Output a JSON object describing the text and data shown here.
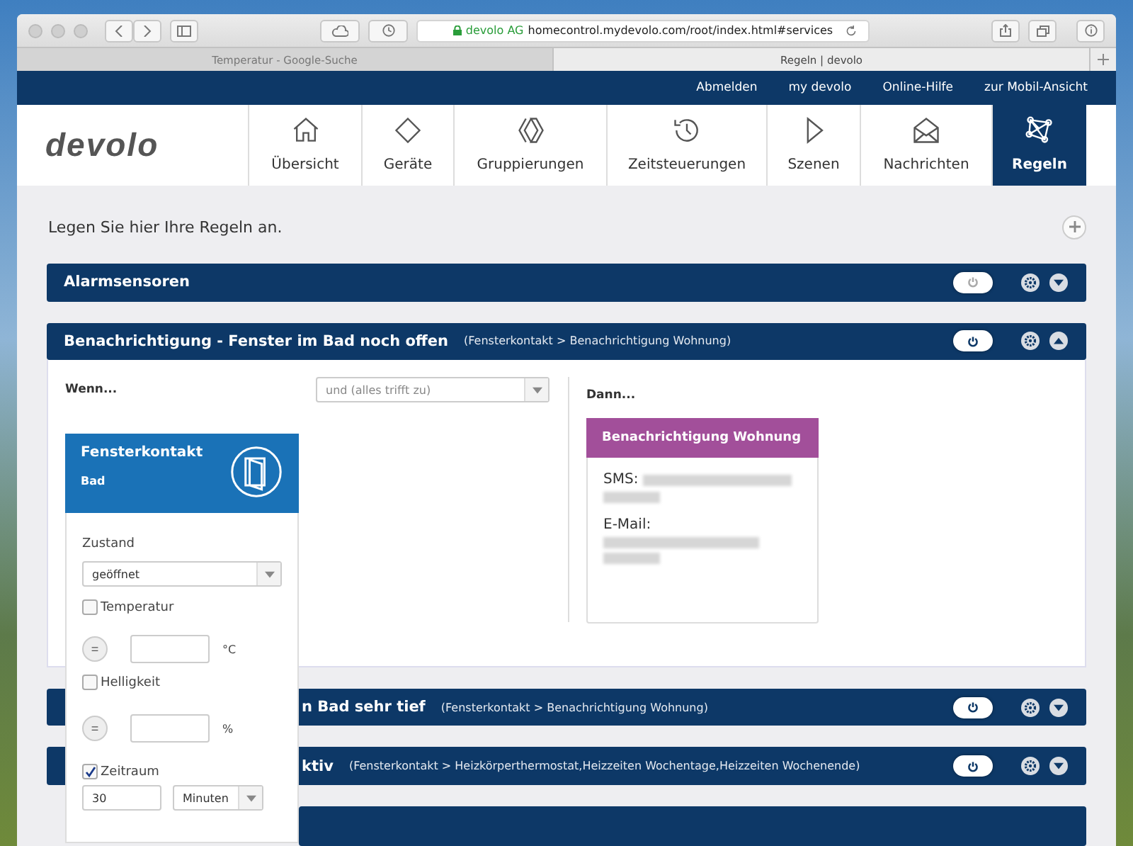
{
  "browser": {
    "tabs": [
      {
        "title": "Temperatur - Google-Suche",
        "selected": false
      },
      {
        "title": "Regeln | devolo",
        "selected": true
      }
    ],
    "address": {
      "owner": "devolo AG",
      "url": "homecontrol.mydevolo.com/root/index.html#services"
    }
  },
  "top_links": [
    "Abmelden",
    "my devolo",
    "Online-Hilfe",
    "zur Mobil-Ansicht"
  ],
  "logo": "devolo",
  "nav": [
    {
      "label": "Übersicht",
      "selected": false
    },
    {
      "label": "Geräte",
      "selected": false
    },
    {
      "label": "Gruppierungen",
      "selected": false
    },
    {
      "label": "Zeitsteuerungen",
      "selected": false
    },
    {
      "label": "Szenen",
      "selected": false
    },
    {
      "label": "Nachrichten",
      "selected": false
    },
    {
      "label": "Regeln",
      "selected": true
    }
  ],
  "intro": "Legen Sie hier Ihre Regeln an.",
  "rules": [
    {
      "title": "Alarmsensoren",
      "on": false,
      "expanded": false
    },
    {
      "title": "Benachrichtigung - Fenster im Bad noch offen",
      "detail": "(Fensterkontakt > Benachrichtigung Wohnung)",
      "on": true,
      "expanded": true
    },
    {
      "title": "n Bad sehr tief",
      "detail": "(Fensterkontakt > Benachrichtigung Wohnung)",
      "on": true,
      "expanded": false
    },
    {
      "title": "ktiv",
      "detail": "(Fensterkontakt > Heizkörperthermostat,Heizzeiten Wochentage,Heizzeiten Wochenende)",
      "on": true,
      "expanded": false
    }
  ],
  "editor": {
    "when_label": "Wenn...",
    "combine": "und (alles trifft zu)",
    "then_label": "Dann...",
    "trigger": {
      "title": "Fensterkontakt",
      "room": "Bad",
      "state_label": "Zustand",
      "state": "geöffnet",
      "conditions": [
        {
          "label": "Temperatur",
          "checked": false,
          "operator": "=",
          "unit": "°C"
        },
        {
          "label": "Helligkeit",
          "checked": false,
          "operator": "=",
          "unit": "%"
        }
      ],
      "period": {
        "label": "Zeitraum",
        "checked": true,
        "value": "30",
        "unit": "Minuten"
      }
    },
    "action": {
      "title": "Benachrichtigung Wohnung",
      "lines": [
        "SMS:",
        "E-Mail:"
      ]
    }
  }
}
